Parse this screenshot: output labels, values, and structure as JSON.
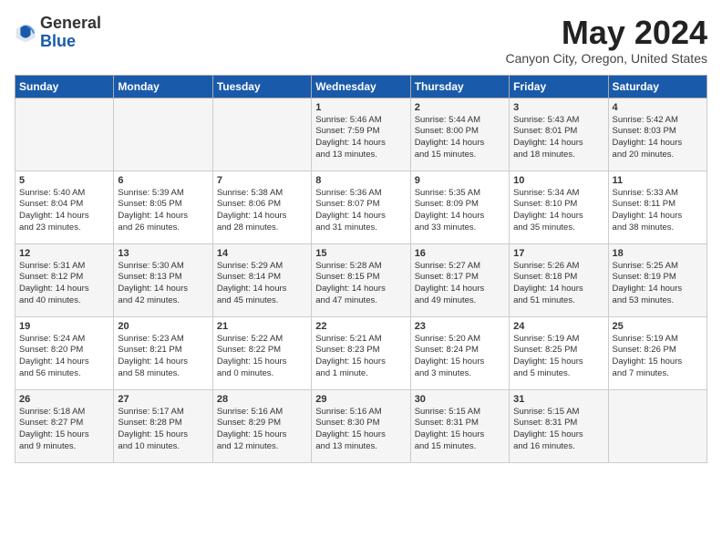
{
  "header": {
    "logo_general": "General",
    "logo_blue": "Blue",
    "title": "May 2024",
    "subtitle": "Canyon City, Oregon, United States"
  },
  "weekdays": [
    "Sunday",
    "Monday",
    "Tuesday",
    "Wednesday",
    "Thursday",
    "Friday",
    "Saturday"
  ],
  "weeks": [
    [
      {
        "day": "",
        "info": ""
      },
      {
        "day": "",
        "info": ""
      },
      {
        "day": "",
        "info": ""
      },
      {
        "day": "1",
        "info": "Sunrise: 5:46 AM\nSunset: 7:59 PM\nDaylight: 14 hours\nand 13 minutes."
      },
      {
        "day": "2",
        "info": "Sunrise: 5:44 AM\nSunset: 8:00 PM\nDaylight: 14 hours\nand 15 minutes."
      },
      {
        "day": "3",
        "info": "Sunrise: 5:43 AM\nSunset: 8:01 PM\nDaylight: 14 hours\nand 18 minutes."
      },
      {
        "day": "4",
        "info": "Sunrise: 5:42 AM\nSunset: 8:03 PM\nDaylight: 14 hours\nand 20 minutes."
      }
    ],
    [
      {
        "day": "5",
        "info": "Sunrise: 5:40 AM\nSunset: 8:04 PM\nDaylight: 14 hours\nand 23 minutes."
      },
      {
        "day": "6",
        "info": "Sunrise: 5:39 AM\nSunset: 8:05 PM\nDaylight: 14 hours\nand 26 minutes."
      },
      {
        "day": "7",
        "info": "Sunrise: 5:38 AM\nSunset: 8:06 PM\nDaylight: 14 hours\nand 28 minutes."
      },
      {
        "day": "8",
        "info": "Sunrise: 5:36 AM\nSunset: 8:07 PM\nDaylight: 14 hours\nand 31 minutes."
      },
      {
        "day": "9",
        "info": "Sunrise: 5:35 AM\nSunset: 8:09 PM\nDaylight: 14 hours\nand 33 minutes."
      },
      {
        "day": "10",
        "info": "Sunrise: 5:34 AM\nSunset: 8:10 PM\nDaylight: 14 hours\nand 35 minutes."
      },
      {
        "day": "11",
        "info": "Sunrise: 5:33 AM\nSunset: 8:11 PM\nDaylight: 14 hours\nand 38 minutes."
      }
    ],
    [
      {
        "day": "12",
        "info": "Sunrise: 5:31 AM\nSunset: 8:12 PM\nDaylight: 14 hours\nand 40 minutes."
      },
      {
        "day": "13",
        "info": "Sunrise: 5:30 AM\nSunset: 8:13 PM\nDaylight: 14 hours\nand 42 minutes."
      },
      {
        "day": "14",
        "info": "Sunrise: 5:29 AM\nSunset: 8:14 PM\nDaylight: 14 hours\nand 45 minutes."
      },
      {
        "day": "15",
        "info": "Sunrise: 5:28 AM\nSunset: 8:15 PM\nDaylight: 14 hours\nand 47 minutes."
      },
      {
        "day": "16",
        "info": "Sunrise: 5:27 AM\nSunset: 8:17 PM\nDaylight: 14 hours\nand 49 minutes."
      },
      {
        "day": "17",
        "info": "Sunrise: 5:26 AM\nSunset: 8:18 PM\nDaylight: 14 hours\nand 51 minutes."
      },
      {
        "day": "18",
        "info": "Sunrise: 5:25 AM\nSunset: 8:19 PM\nDaylight: 14 hours\nand 53 minutes."
      }
    ],
    [
      {
        "day": "19",
        "info": "Sunrise: 5:24 AM\nSunset: 8:20 PM\nDaylight: 14 hours\nand 56 minutes."
      },
      {
        "day": "20",
        "info": "Sunrise: 5:23 AM\nSunset: 8:21 PM\nDaylight: 14 hours\nand 58 minutes."
      },
      {
        "day": "21",
        "info": "Sunrise: 5:22 AM\nSunset: 8:22 PM\nDaylight: 15 hours\nand 0 minutes."
      },
      {
        "day": "22",
        "info": "Sunrise: 5:21 AM\nSunset: 8:23 PM\nDaylight: 15 hours\nand 1 minute."
      },
      {
        "day": "23",
        "info": "Sunrise: 5:20 AM\nSunset: 8:24 PM\nDaylight: 15 hours\nand 3 minutes."
      },
      {
        "day": "24",
        "info": "Sunrise: 5:19 AM\nSunset: 8:25 PM\nDaylight: 15 hours\nand 5 minutes."
      },
      {
        "day": "25",
        "info": "Sunrise: 5:19 AM\nSunset: 8:26 PM\nDaylight: 15 hours\nand 7 minutes."
      }
    ],
    [
      {
        "day": "26",
        "info": "Sunrise: 5:18 AM\nSunset: 8:27 PM\nDaylight: 15 hours\nand 9 minutes."
      },
      {
        "day": "27",
        "info": "Sunrise: 5:17 AM\nSunset: 8:28 PM\nDaylight: 15 hours\nand 10 minutes."
      },
      {
        "day": "28",
        "info": "Sunrise: 5:16 AM\nSunset: 8:29 PM\nDaylight: 15 hours\nand 12 minutes."
      },
      {
        "day": "29",
        "info": "Sunrise: 5:16 AM\nSunset: 8:30 PM\nDaylight: 15 hours\nand 13 minutes."
      },
      {
        "day": "30",
        "info": "Sunrise: 5:15 AM\nSunset: 8:31 PM\nDaylight: 15 hours\nand 15 minutes."
      },
      {
        "day": "31",
        "info": "Sunrise: 5:15 AM\nSunset: 8:31 PM\nDaylight: 15 hours\nand 16 minutes."
      },
      {
        "day": "",
        "info": ""
      }
    ]
  ]
}
